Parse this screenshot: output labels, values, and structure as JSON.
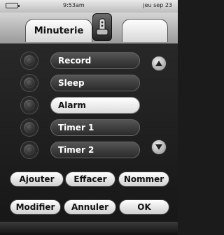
{
  "status": {
    "time": "9:53am",
    "date": "jeu sep 23",
    "battery_icon": "battery-icon"
  },
  "header": {
    "active_tab": "Minuterie",
    "device_icon": "remote-control-icon"
  },
  "list": {
    "items": [
      {
        "label": "Record",
        "selected": false
      },
      {
        "label": "Sleep",
        "selected": false
      },
      {
        "label": "Alarm",
        "selected": true
      },
      {
        "label": "Timer 1",
        "selected": false
      },
      {
        "label": "Timer 2",
        "selected": false
      }
    ],
    "scroll_up_icon": "triangle-up-icon",
    "scroll_down_icon": "triangle-down-icon"
  },
  "buttons": {
    "ajouter": "Ajouter",
    "effacer": "Effacer",
    "nommer": "Nommer",
    "modifier": "Modifier",
    "annuler": "Annuler",
    "ok": "OK"
  },
  "colors": {
    "background": "#1b1b1b",
    "selected_item": "#ffffff",
    "item": "#3a3a3a"
  }
}
